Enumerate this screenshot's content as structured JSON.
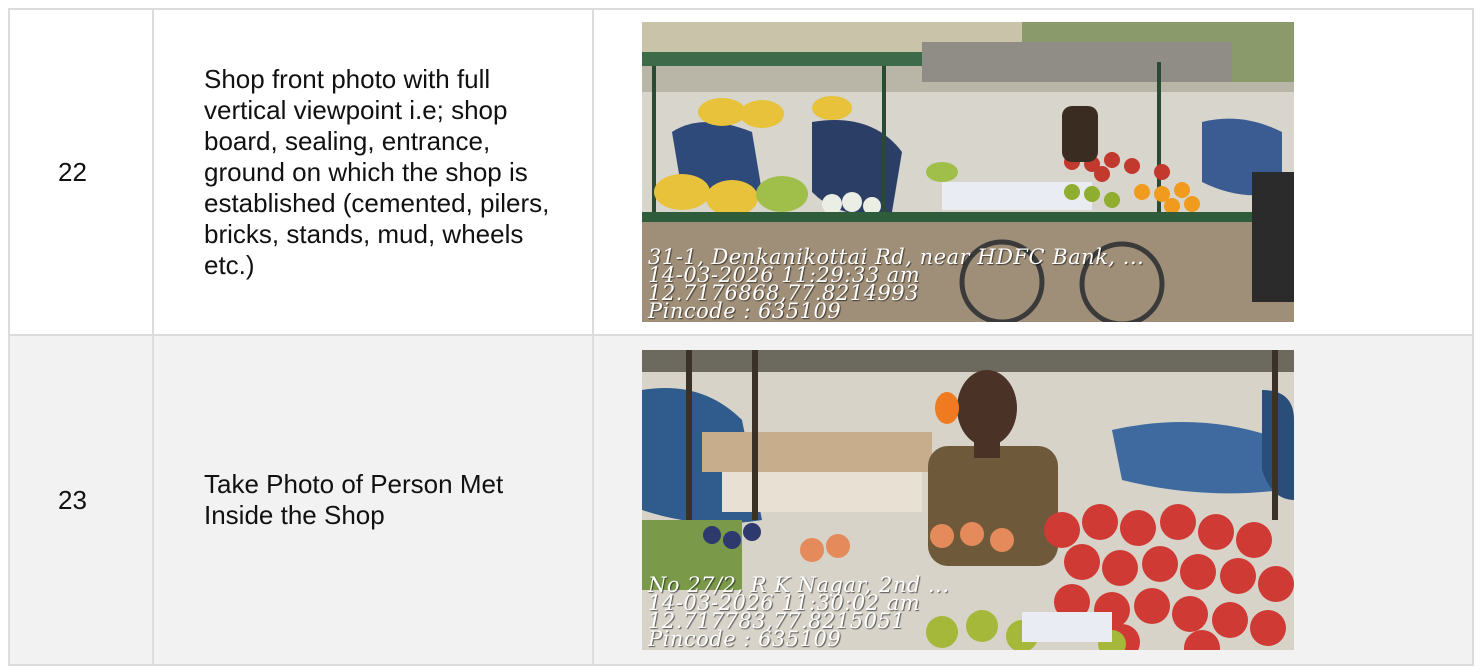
{
  "rows": [
    {
      "number": "22",
      "description": "Shop front photo with full vertical viewpoint i.e; shop board, sealing, entrance, ground on which the shop is established (cemented, pilers, bricks, stands, mud, wheels etc.)",
      "photo": {
        "subject": "fruit stall cart with bananas, apples and oranges in front of a painted wall",
        "stamp": [
          "31-1, Denkanikottai Rd, near HDFC Bank, ...",
          "14-03-2026 11:29:33 am",
          "12.7176868,77.8214993",
          "Pincode : 635109"
        ]
      }
    },
    {
      "number": "23",
      "description": "Take Photo of Person Met Inside the Shop",
      "photo": {
        "subject": "vendor standing behind a pile of apples at a fruit stall",
        "stamp": [
          "No 27/2, R K Nagar, 2nd ...",
          "14-03-2026 11:30:02 am",
          "12.717783,77.8215051",
          "Pincode : 635109"
        ]
      }
    }
  ],
  "colors": {
    "border": "#dcdcdc",
    "row_alt_background": "#f2f2f2"
  }
}
